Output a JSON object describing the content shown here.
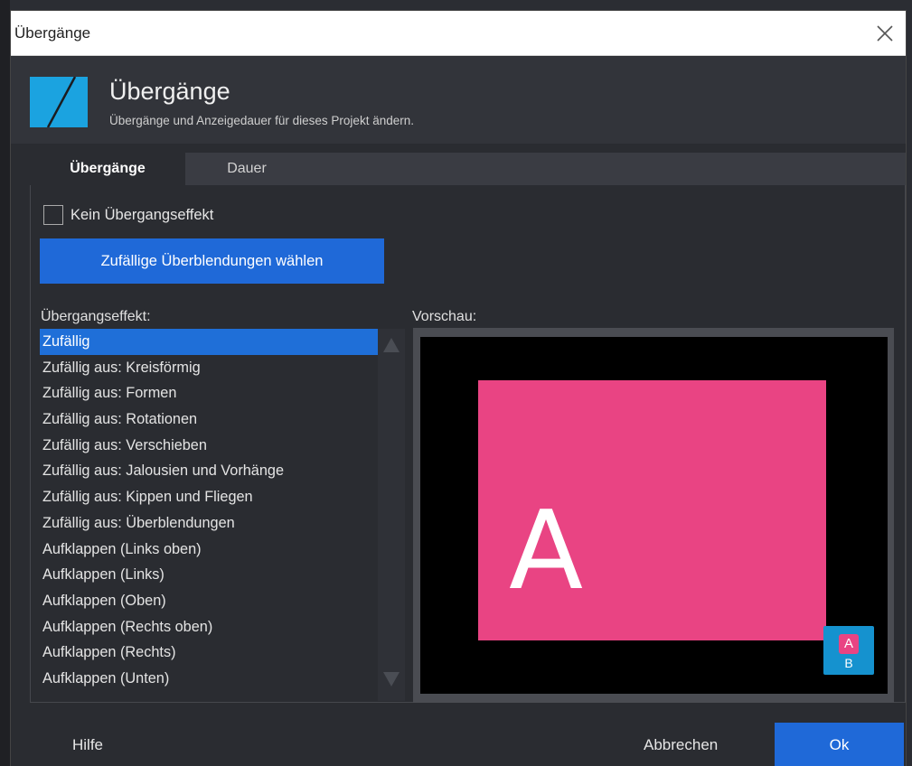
{
  "window": {
    "title": "Übergänge"
  },
  "header": {
    "title": "Übergänge",
    "subtitle": "Übergänge und Anzeigedauer für dieses Projekt ändern."
  },
  "tabs": [
    {
      "label": "Übergänge",
      "active": true
    },
    {
      "label": "Dauer",
      "active": false
    }
  ],
  "options": {
    "no_transition_label": "Kein Übergangseffekt",
    "no_transition_checked": false,
    "random_button_label": "Zufällige Überblendungen wählen"
  },
  "effects": {
    "caption": "Übergangseffekt:",
    "selected_index": 0,
    "items": [
      "Zufällig",
      "Zufällig aus: Kreisförmig",
      "Zufällig aus: Formen",
      "Zufällig aus: Rotationen",
      "Zufällig aus: Verschieben",
      "Zufällig aus: Jalousien und Vorhänge",
      "Zufällig aus: Kippen und Fliegen",
      "Zufällig aus: Überblendungen",
      "Aufklappen (Links oben)",
      "Aufklappen (Links)",
      "Aufklappen (Oben)",
      "Aufklappen (Rechts oben)",
      "Aufklappen (Rechts)",
      "Aufklappen (Unten)"
    ]
  },
  "preview": {
    "caption": "Vorschau:",
    "slide_letter": "A",
    "badge_a": "A",
    "badge_b": "B",
    "slide_color": "#e94483",
    "badge_color": "#1592cf"
  },
  "footer": {
    "help_label": "Hilfe",
    "cancel_label": "Abbrechen",
    "ok_label": "Ok"
  },
  "colors": {
    "accent": "#1f69d8",
    "selection": "#1f6fd8",
    "logo": "#1ba3e0"
  }
}
